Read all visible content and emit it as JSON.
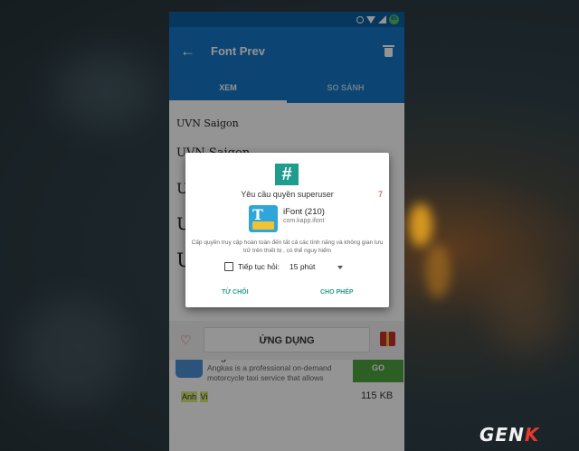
{
  "app_bar": {
    "back_icon": "arrow-left-icon",
    "title": "Font Prev",
    "delete_icon": "trash-icon"
  },
  "tabs": [
    {
      "label": "XEM",
      "active": true
    },
    {
      "label": "SO SÁNH",
      "active": false
    }
  ],
  "samples": [
    {
      "text": "UVN Saigon"
    },
    {
      "text": "UVN Saigon"
    },
    {
      "text": "U"
    },
    {
      "text": "U"
    },
    {
      "text": "U"
    }
  ],
  "dialog": {
    "logo_text": "#",
    "title": "Yêu cầu quyền superuser",
    "countdown": "7",
    "app_name": "iFont (210)",
    "package": "com.kapp.ifont",
    "description": "Cấp quyền truy cập hoàn toàn đến tất cả các tính năng và không gian lưu trữ trên thiết bị , có thể nguy hiểm",
    "remember_label": "Tiếp tục hỏi:",
    "remember_value": "15 phút",
    "deny_label": "TỪ CHỐI",
    "allow_label": "CHO PHÉP"
  },
  "ad": {
    "title": "Angkas",
    "description": "Angkas is a professional on-demand motorcycle taxi service that allows",
    "go_label": "GO",
    "tag_1": "Anh",
    "tag_2": "Vi",
    "size": "115 KB"
  },
  "bottom_bar": {
    "button_label": "ỨNG DỤNG",
    "heart_icon": "heart-icon",
    "gift_icon": "gift-icon"
  },
  "watermark": {
    "text_main": "GEN",
    "text_accent": "K"
  },
  "colors": {
    "primary": "#1677c6",
    "status_bar": "#0d5fa1",
    "accent": "#2a9d8f",
    "go_button": "#4fa23e",
    "superuser": "#1f9c8e"
  }
}
